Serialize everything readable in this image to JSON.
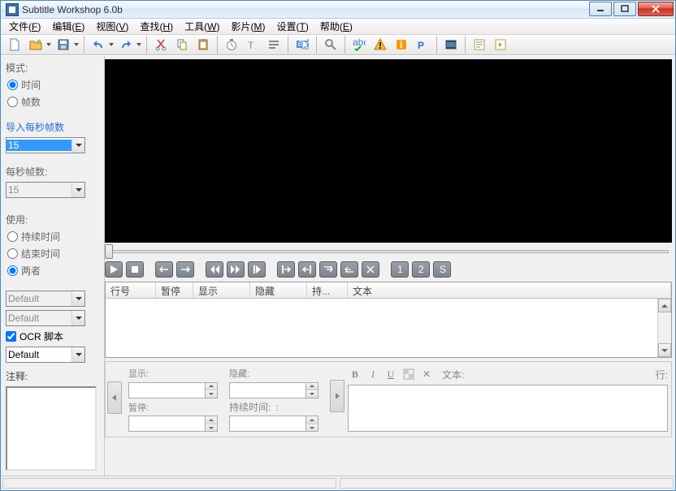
{
  "window": {
    "title": "Subtitle Workshop 6.0b"
  },
  "menus": [
    {
      "label": "文件",
      "key": "F"
    },
    {
      "label": "编辑",
      "key": "E"
    },
    {
      "label": "视图",
      "key": "V"
    },
    {
      "label": "查找",
      "key": "H"
    },
    {
      "label": "工具",
      "key": "W"
    },
    {
      "label": "影片",
      "key": "M"
    },
    {
      "label": "设置",
      "key": "T"
    },
    {
      "label": "帮助",
      "key": "E"
    }
  ],
  "sidebar": {
    "mode_label": "模式:",
    "mode_time": "时间",
    "mode_frames": "帧数",
    "input_fps_label": "导入每秒帧数",
    "input_fps_value": "15",
    "fps_label": "每秒帧数:",
    "fps_value": "15",
    "use_label": "使用:",
    "use_duration": "持续时间",
    "use_end": "结束时间",
    "use_both": "两者",
    "default1": "Default",
    "default2": "Default",
    "default3": "Default",
    "ocr_label": "OCR 脚本",
    "notes_label": "注释:"
  },
  "grid": {
    "cols": [
      "行号",
      "暂停",
      "显示",
      "隐藏",
      "持...",
      "文本"
    ]
  },
  "edit": {
    "show": "显示:",
    "hide": "隐藏:",
    "pause": "暂停:",
    "duration": "持续时间:",
    "colon": ":",
    "text": "文本:",
    "line": "行:"
  },
  "fmt": {
    "b": "B",
    "i": "I",
    "u": "U",
    "x": "✕"
  }
}
